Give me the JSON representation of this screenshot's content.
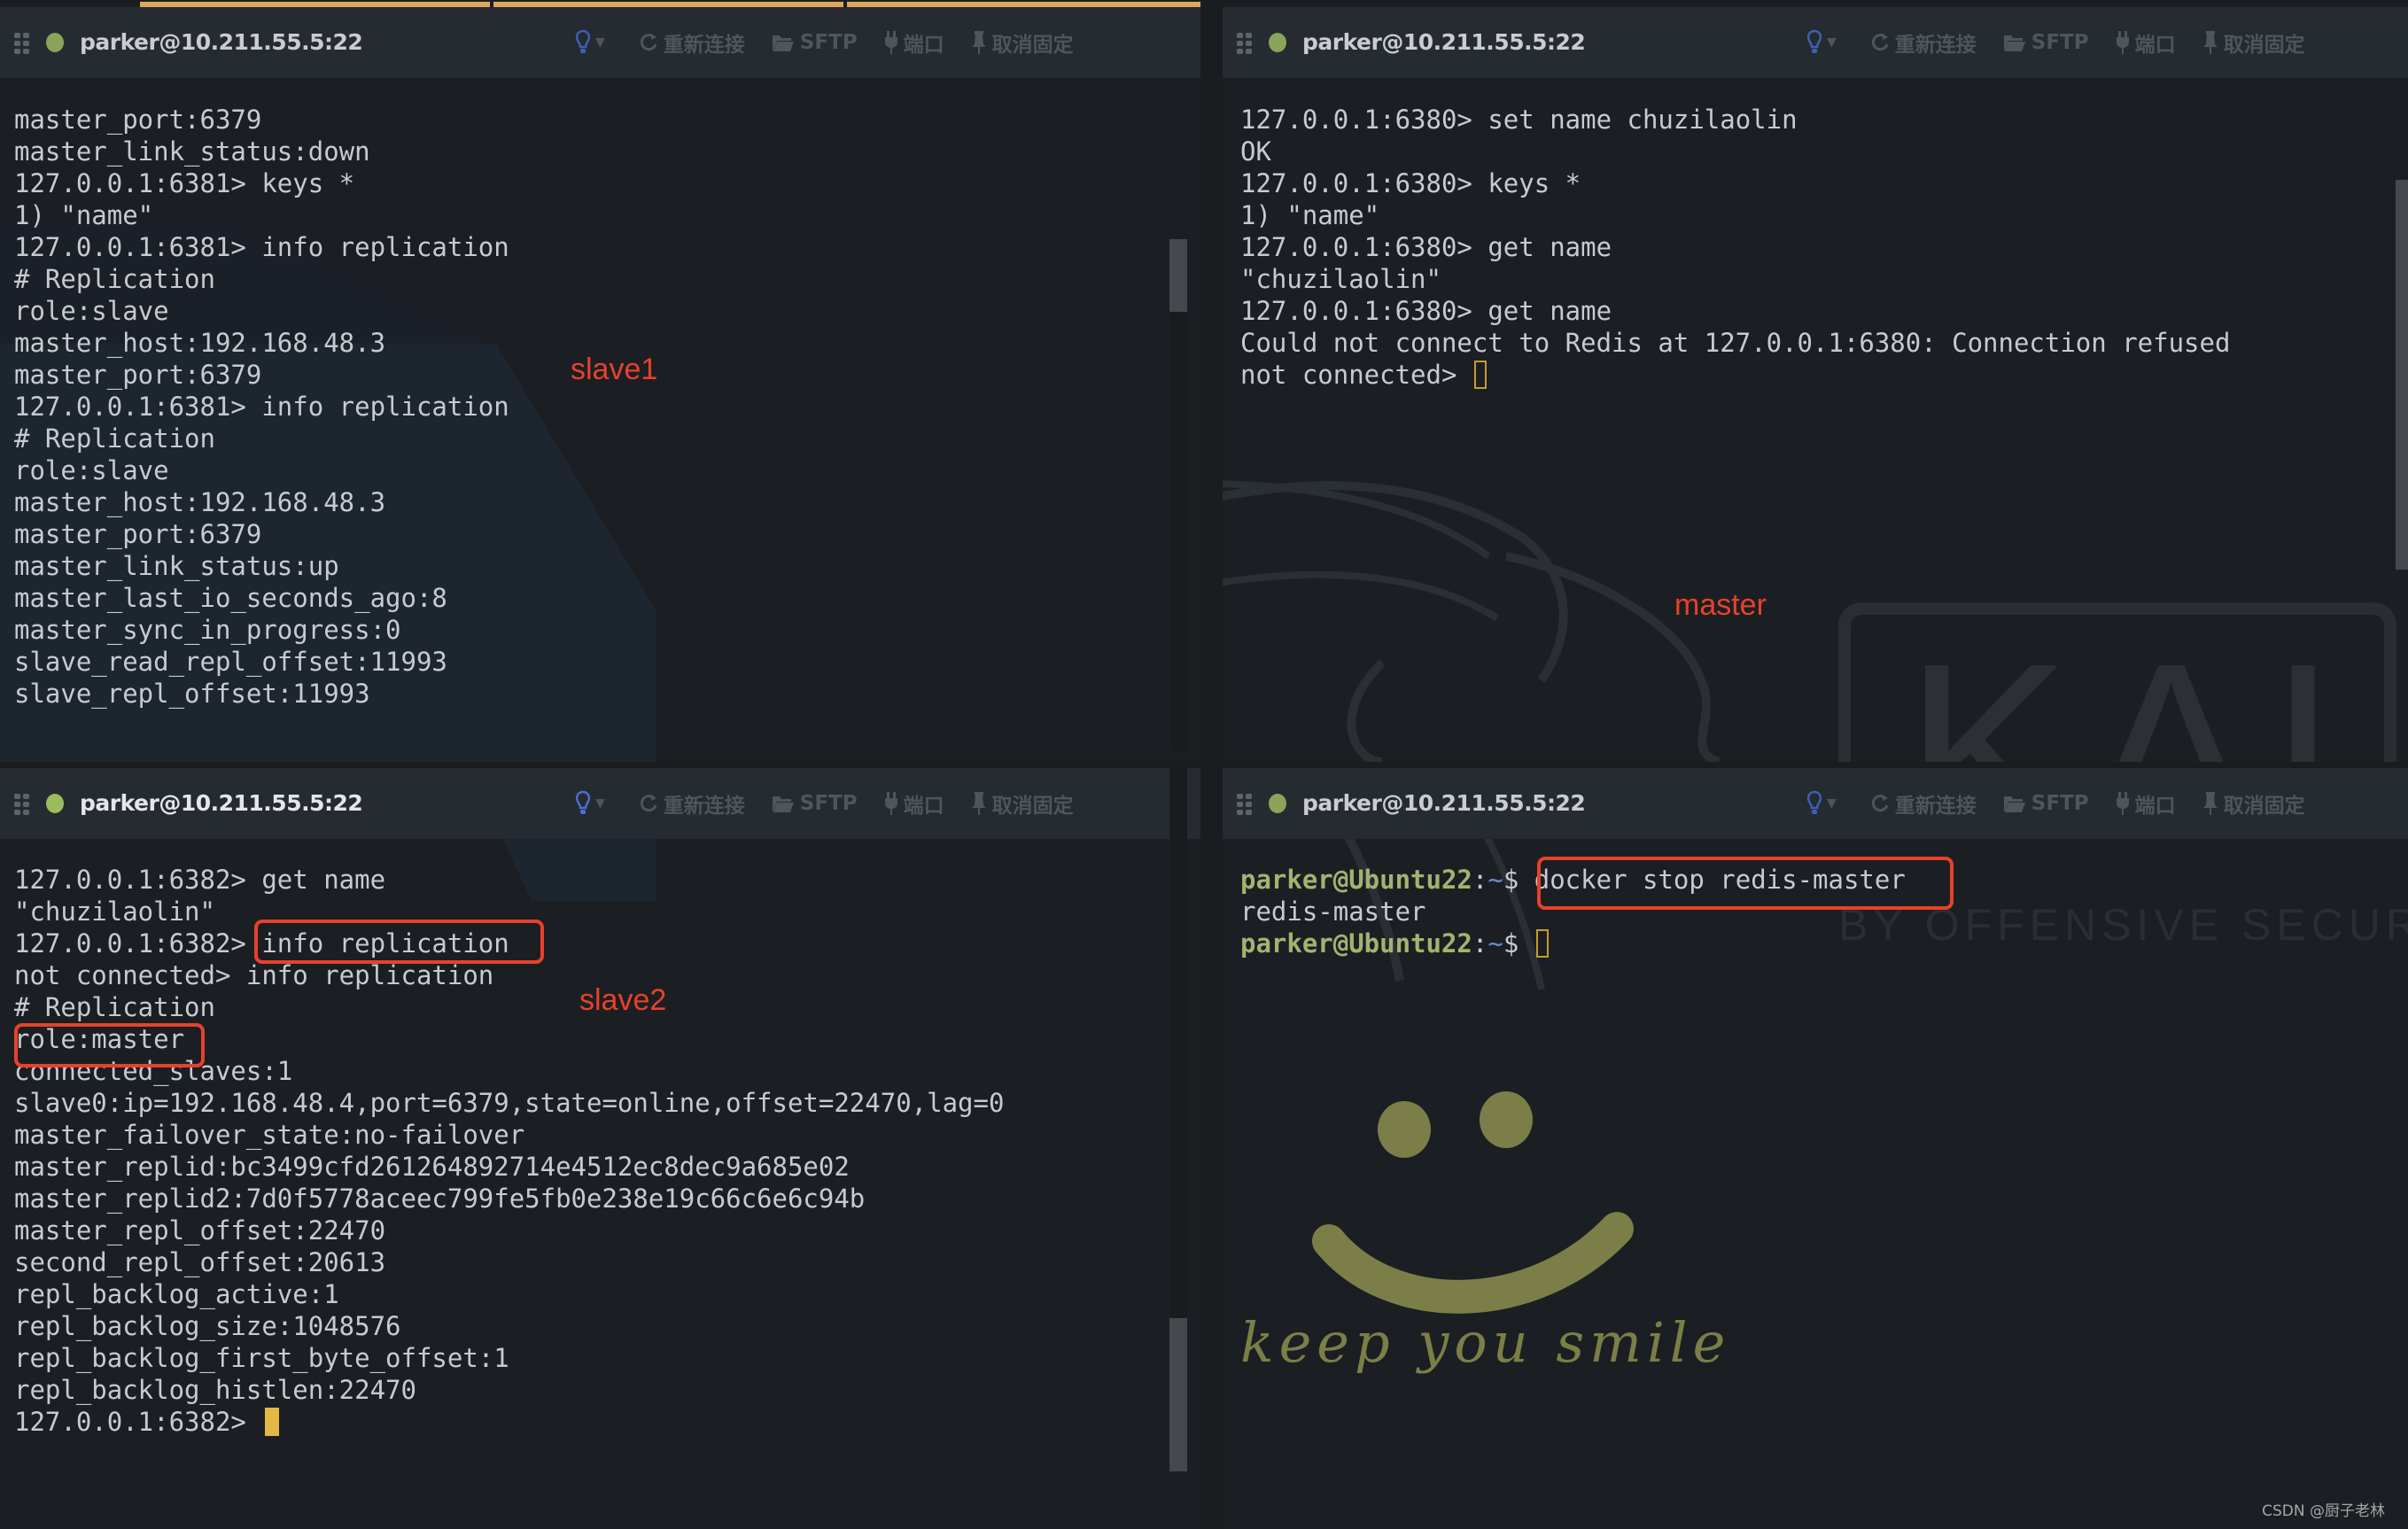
{
  "tabbar": {
    "segments": 3,
    "accent": "#e0a85a"
  },
  "panes": [
    {
      "id": "top-left",
      "header": {
        "host": "parker@10.211.55.5:22",
        "status": "connected",
        "tools": {
          "reconnect": "重新连接",
          "sftp": "SFTP",
          "port": "端口",
          "unpin": "取消固定"
        }
      },
      "annotation": "slave1",
      "lines": [
        "master_port:6379",
        "master_link_status:down",
        "127.0.0.1:6381> keys *",
        "1) \"name\"",
        "127.0.0.1:6381> info replication",
        "# Replication",
        "role:slave",
        "master_host:192.168.48.3",
        "master_port:6379",
        "127.0.0.1:6381> info replication",
        "# Replication",
        "role:slave",
        "master_host:192.168.48.3",
        "master_port:6379",
        "master_link_status:up",
        "master_last_io_seconds_ago:8",
        "master_sync_in_progress:0",
        "slave_read_repl_offset:11993",
        "slave_repl_offset:11993"
      ]
    },
    {
      "id": "top-right",
      "header": {
        "host": "parker@10.211.55.5:22",
        "status": "connected",
        "tools": {
          "reconnect": "重新连接",
          "sftp": "SFTP",
          "port": "端口",
          "unpin": "取消固定"
        }
      },
      "annotation": "master",
      "lines": [
        "127.0.0.1:6380> set name chuzilaolin",
        "OK",
        "127.0.0.1:6380> keys *",
        "1) \"name\"",
        "127.0.0.1:6380> get name",
        "\"chuzilaolin\"",
        "127.0.0.1:6380> get name",
        "Could not connect to Redis at 127.0.0.1:6380: Connection refused"
      ],
      "prompt": "not connected> ",
      "watermark": {
        "logo": "KALI",
        "tagline": "BY OFFENSIVE SECURITY"
      }
    },
    {
      "id": "bottom-left",
      "header": {
        "host": "parker@10.211.55.5:22",
        "status": "connected",
        "tools": {
          "reconnect": "重新连接",
          "sftp": "SFTP",
          "port": "端口",
          "unpin": "取消固定"
        }
      },
      "annotation": "slave2",
      "lines": [
        "127.0.0.1:6382> get name",
        "\"chuzilaolin\"",
        "127.0.0.1:6382> info replication",
        "not connected> info replication",
        "# Replication",
        "role:master",
        "connected_slaves:1",
        "slave0:ip=192.168.48.4,port=6379,state=online,offset=22470,lag=0",
        "master_failover_state:no-failover",
        "master_replid:bc3499cfd261264892714e4512ec8dec9a685e02",
        "master_replid2:7d0f5778aceec799fe5fb0e238e19c66c6e6c94b",
        "master_repl_offset:22470",
        "second_repl_offset:20613",
        "repl_backlog_active:1",
        "repl_backlog_size:1048576",
        "repl_backlog_first_byte_offset:1",
        "repl_backlog_histlen:22470"
      ],
      "prompt": "127.0.0.1:6382> "
    },
    {
      "id": "bottom-right",
      "header": {
        "host": "parker@10.211.55.5:22",
        "status": "connected",
        "tools": {
          "reconnect": "重新连接",
          "sftp": "SFTP",
          "port": "端口",
          "unpin": "取消固定"
        }
      },
      "shell_user": "parker@Ubuntu22",
      "shell_sep": ":",
      "shell_path": "~",
      "shell_sigil": "$ ",
      "command": "docker stop redis-master",
      "output": "redis-master",
      "wallpaper_text": "keep you smile"
    }
  ],
  "footer_watermark": "CSDN @厨子老林",
  "colors": {
    "annotation_red": "#e8412a",
    "status_green": "#8ba35a",
    "cursor_yellow": "#e2b945",
    "prompt_green": "#a3b370",
    "smile_olive": "#7b7e47"
  }
}
